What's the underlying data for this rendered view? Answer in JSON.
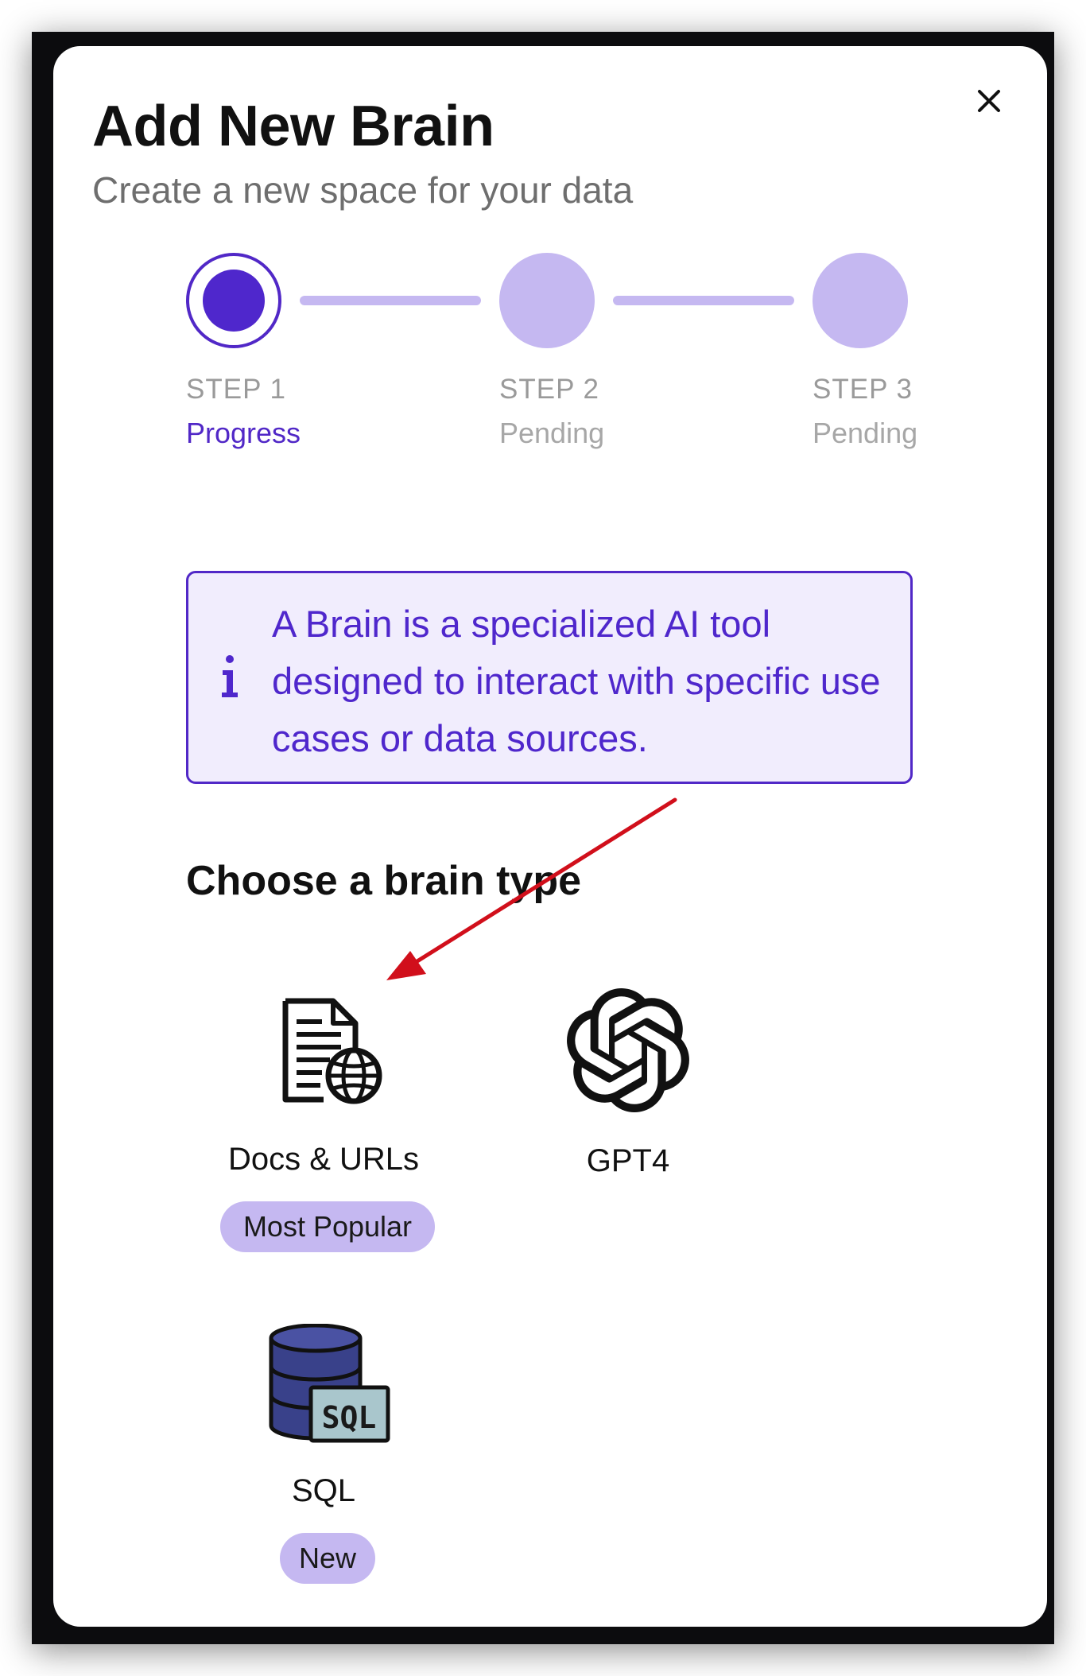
{
  "modal": {
    "title": "Add New Brain",
    "subtitle": "Create a new space for your data",
    "close_icon": "close-icon"
  },
  "stepper": {
    "steps": [
      {
        "label": "STEP 1",
        "status": "Progress",
        "state": "active"
      },
      {
        "label": "STEP 2",
        "status": "Pending",
        "state": "pending"
      },
      {
        "label": "STEP 3",
        "status": "Pending",
        "state": "pending"
      }
    ]
  },
  "info": {
    "icon": "info-icon",
    "text": "A Brain is a specialized AI tool designed to interact with specific use cases or data sources."
  },
  "brain_types": {
    "heading": "Choose a brain type",
    "options": [
      {
        "label": "Docs & URLs",
        "badge": "Most Popular",
        "icon": "document-globe-icon"
      },
      {
        "label": "GPT4",
        "badge": "",
        "icon": "openai-icon"
      },
      {
        "label": "SQL",
        "badge": "New",
        "icon": "sql-database-icon",
        "icon_text": "SQL"
      }
    ]
  },
  "colors": {
    "accent": "#4f27cc",
    "accent_light": "#c5b8f1",
    "info_bg": "#f1edfd",
    "annotation_arrow": "#d10f1b"
  }
}
